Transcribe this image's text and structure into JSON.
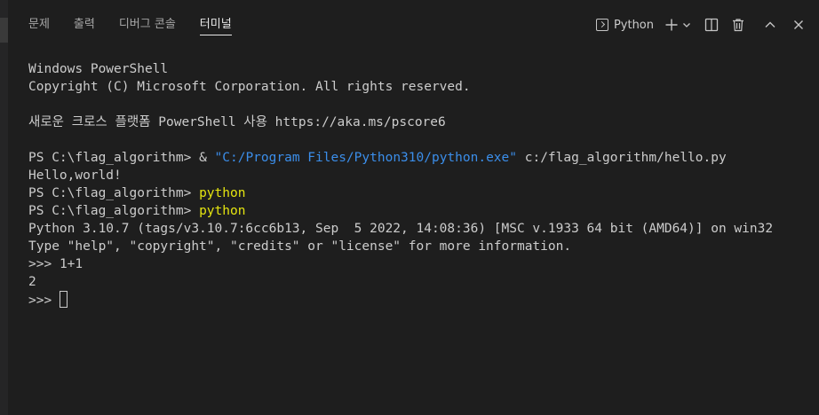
{
  "tabs": [
    {
      "label": "문제"
    },
    {
      "label": "출력"
    },
    {
      "label": "디버그 콘솔"
    },
    {
      "label": "터미널",
      "active": true
    }
  ],
  "toolbar": {
    "shell_name": "Python",
    "icons": [
      "terminal-icon",
      "plus-icon",
      "chevron-down-icon",
      "split-icon",
      "trash-icon",
      "chevron-up-icon",
      "close-icon"
    ]
  },
  "terminal": {
    "banner1": "Windows PowerShell",
    "banner2": "Copyright (C) Microsoft Corporation. All rights reserved.",
    "banner3": "새로운 크로스 플랫폼 PowerShell 사용 https://aka.ms/pscore6",
    "prompt": "PS C:\\flag_algorithm>",
    "run_amp": "&",
    "run_exe": "\"C:/Program Files/Python310/python.exe\"",
    "run_script": "c:/flag_algorithm/hello.py",
    "output_hello": "Hello,world!",
    "cmd_python": "python",
    "py_version": "Python 3.10.7 (tags/v3.10.7:6cc6b13, Sep  5 2022, 14:08:36) [MSC v.1933 64 bit (AMD64)] on win32",
    "py_help": "Type \"help\", \"copyright\", \"credits\" or \"license\" for more information.",
    "repl_prompt": ">>>",
    "repl_input": "1+1",
    "repl_output": "2"
  },
  "colors": {
    "background": "#1e1e1e",
    "text": "#cccccc",
    "string": "#3b8eea",
    "command": "#e5e510"
  }
}
